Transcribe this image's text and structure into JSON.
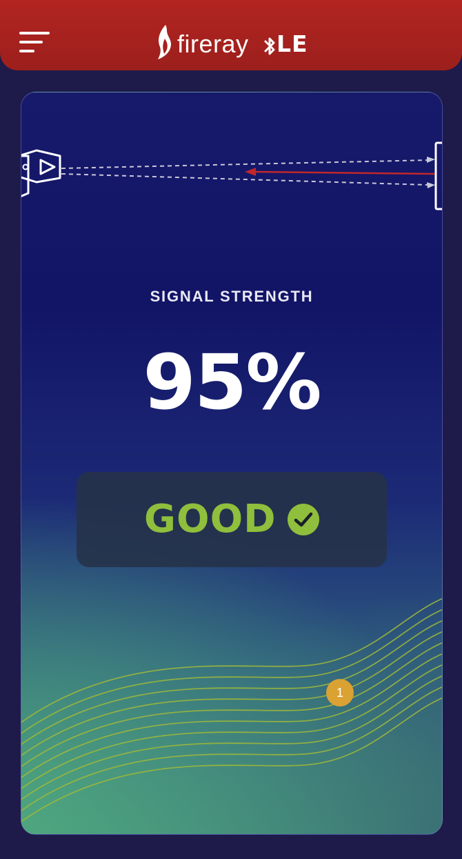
{
  "header": {
    "brand_word": "fireray",
    "brand_suffix": "LE",
    "menu_icon": "hamburger-menu-icon",
    "flame_icon": "flame-icon",
    "bluetooth_icon": "bluetooth-icon",
    "background_color": "#b22521"
  },
  "main": {
    "signal_label": "SIGNAL STRENGTH",
    "signal_value": "95%",
    "status_label": "GOOD",
    "status_icon": "check-circle-icon",
    "status_color": "#8fbf3c",
    "badge_number": "1",
    "badge_color": "#d9a233"
  },
  "illustration": {
    "detector_icon": "beam-detector-icon",
    "reflector_icon": "reflector-icon",
    "beam_color": "#c0282b"
  }
}
